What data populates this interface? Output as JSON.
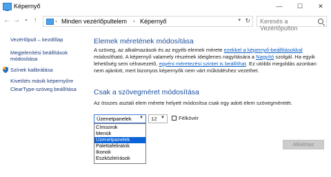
{
  "window": {
    "title": "Képernyő",
    "minimize": "—",
    "maximize": "☐",
    "close": "✕"
  },
  "address": {
    "crumb_root": "Minden vezérlőpultelem",
    "crumb_current": "Képernyő",
    "separator": "›",
    "search_placeholder": "Keresés a Vezérlőpulton"
  },
  "sidebar": {
    "items": [
      "Vezérlőpult – kezdőlap",
      "Megjelenítési beállítások módosítása",
      "Színek kalibrálása",
      "Kivetítés másik képernyőre",
      "ClearType-szöveg beállítása"
    ]
  },
  "main": {
    "heading1": "Elemek méretének módosítása",
    "para1": {
      "t1": "A szöveg, az alkalmazások és az egyéb elemek mérete ",
      "link1": "ezekkel a képernyő-beállításokkal",
      "t2": " módosítható. A képernyő valamely részének ideiglenes nagyítására a ",
      "link2": "Nagyító",
      "t3": " szolgál. Ha egyik lehetőség sem célravezető, ",
      "link3": "egyéni méretezési szintet is beállíthat",
      "t4": ". Ez utóbbi megoldás azonban nem ajánlott, mert bizonyos képernyők nem várt működéshez vezethet."
    },
    "heading2": "Csak a szövegméret módosítása",
    "para2": "Az összes asztali elem mérete helyett módosítsa csak egy adott elem szövegméretét.",
    "element_select": {
      "value": "Üzenetpanelek",
      "options": [
        "Címsorok",
        "Menük",
        "Üzenetpanelek",
        "Palettafeliratok",
        "Ikonok",
        "Eszközleírások"
      ],
      "selected_index": 2
    },
    "size_select": {
      "value": "12"
    },
    "bold_label": "Félkövér",
    "bold_checked": false,
    "apply_label": "Alkalmaz"
  },
  "colors": {
    "heading": "#1c4fa0",
    "link": "#0b5fc4",
    "selection": "#0a64d8"
  }
}
